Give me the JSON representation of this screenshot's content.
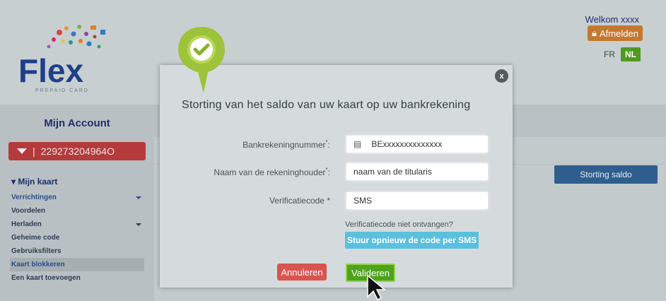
{
  "header": {
    "logo_text": "Flex",
    "logo_subtext": "PREPAID CARD",
    "welcome": "Welkom xxxx",
    "logout_label": "Afmelden",
    "lang_fr": "FR",
    "lang_nl": "NL"
  },
  "sidebar": {
    "title": "Mijn Account",
    "card_number": "229273204964O",
    "section_title": "Mijn kaart",
    "items": [
      {
        "label": "Verrichtingen"
      },
      {
        "label": "Voordelen"
      },
      {
        "label": "Herladen"
      },
      {
        "label": "Geheime code"
      },
      {
        "label": "Gebruiksfilters"
      },
      {
        "label": "Kaart blokkeren"
      },
      {
        "label": "Een kaart toevoegen"
      }
    ]
  },
  "main": {
    "storting_button": "Storting saldo"
  },
  "modal": {
    "title": "Storting van het saldo van uw kaart op uw bankrekening",
    "close_label": "x",
    "fields": {
      "bank_label": "Bankrekeningnummer",
      "bank_value": "BExxxxxxxxxxxxxx",
      "holder_label": "Naam van de rekeninghouder",
      "holder_value": "naam van de titularis",
      "code_label": "Verificatiecode *",
      "code_value": "SMS"
    },
    "required_mark": "*",
    "hint": "Verificatiecode niet ontvangen?",
    "resend_button": "Stuur opnieuw de code per SMS",
    "cancel_button": "Annuleren",
    "validate_button": "Valideren"
  },
  "colors": {
    "accent_green": "#4ea21d",
    "danger_red": "#d9534f",
    "info_blue": "#5bc0de",
    "navy": "#1e2f6a"
  }
}
